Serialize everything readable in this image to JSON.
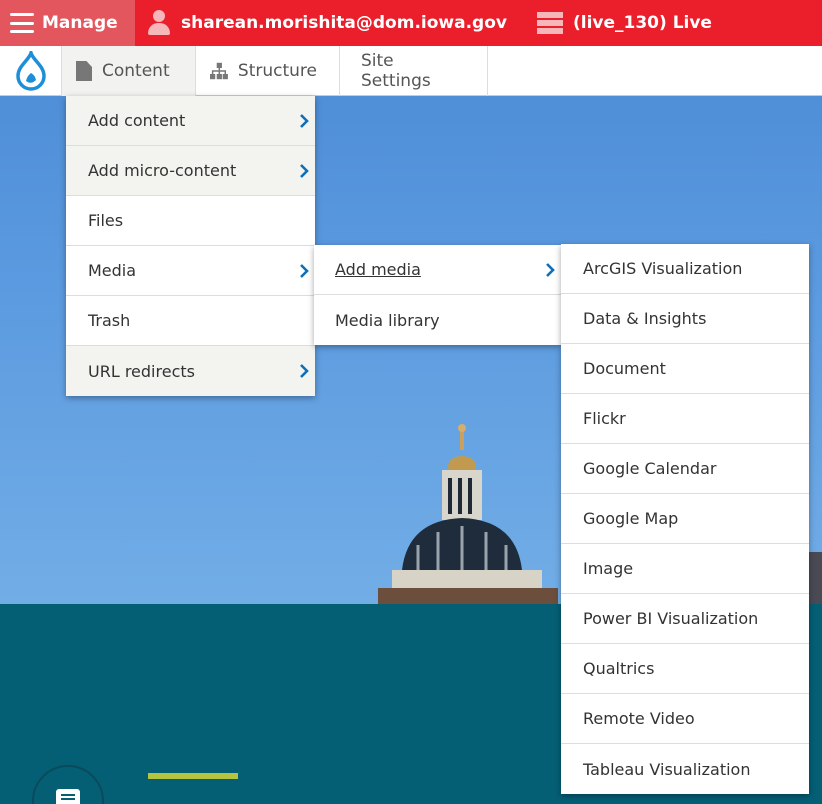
{
  "topbar": {
    "manage_label": "Manage",
    "user_email": "sharean.morishita@dom.iowa.gov",
    "environment_label": "(live_130) Live"
  },
  "toolbar": {
    "content_label": "Content",
    "structure_label": "Structure",
    "site_settings_label": "Site Settings"
  },
  "content_menu": {
    "items": [
      {
        "label": "Add content"
      },
      {
        "label": "Add micro-content"
      },
      {
        "label": "Files"
      },
      {
        "label": "Media"
      },
      {
        "label": "Trash"
      },
      {
        "label": "URL redirects"
      }
    ]
  },
  "media_menu": {
    "items": [
      {
        "label": "Add media"
      },
      {
        "label": "Media library"
      }
    ]
  },
  "add_media_menu": {
    "items": [
      {
        "label": "ArcGIS Visualization"
      },
      {
        "label": "Data & Insights"
      },
      {
        "label": "Document"
      },
      {
        "label": "Flickr"
      },
      {
        "label": "Google Calendar"
      },
      {
        "label": "Google Map"
      },
      {
        "label": "Image"
      },
      {
        "label": "Power BI Visualization"
      },
      {
        "label": "Qualtrics"
      },
      {
        "label": "Remote Video"
      },
      {
        "label": "Tableau Visualization"
      }
    ]
  },
  "colors": {
    "admin_bar": "#ea1f2b",
    "manage_tab": "#e4565d",
    "chevron": "#0f6fb8",
    "drupal_drop": "#1d8fd8"
  }
}
